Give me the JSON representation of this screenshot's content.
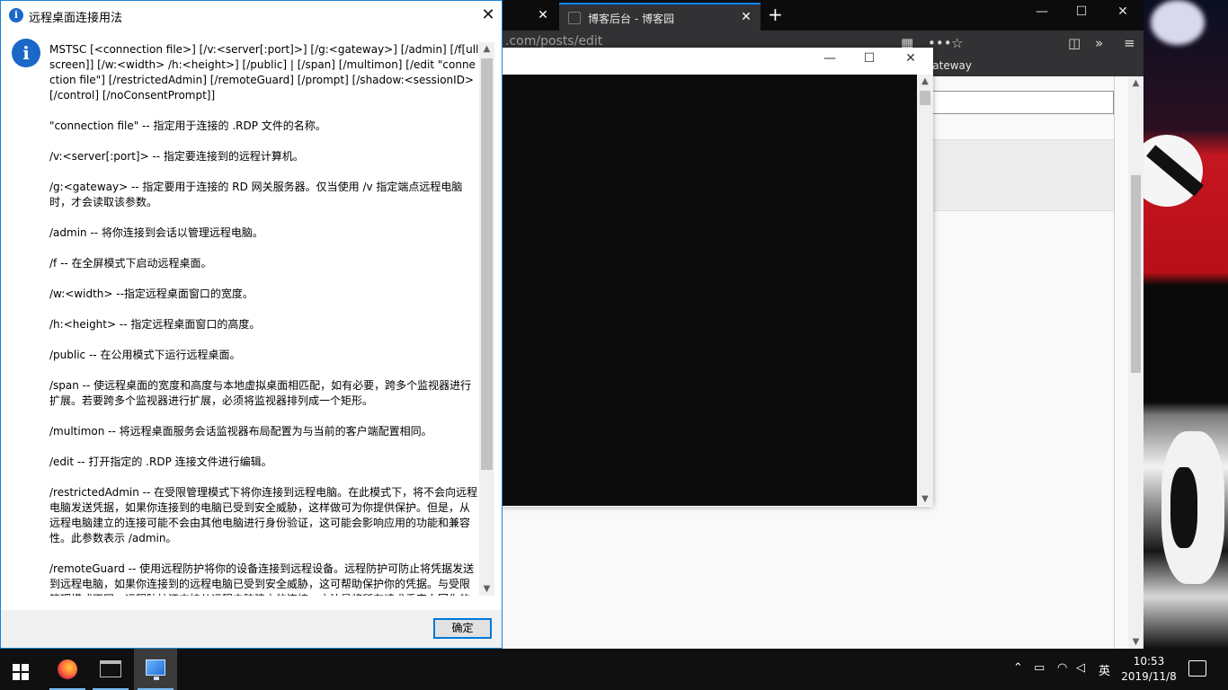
{
  "dialog": {
    "title": "远程桌面连接用法",
    "close_glyph": "✕",
    "ok_label": "确定",
    "paragraphs": [
      "MSTSC [<connection file>] [/v:<server[:port]>] [/g:<gateway>] [/admin] [/f[ullscreen]] [/w:<width> /h:<height>] [/public] | [/span] [/multimon] [/edit \"connection file\"] [/restrictedAdmin] [/remoteGuard] [/prompt] [/shadow:<sessionID> [/control] [/noConsentPrompt]]",
      "\"connection file\" -- 指定用于连接的 .RDP 文件的名称。",
      "/v:<server[:port]> -- 指定要连接到的远程计算机。",
      "/g:<gateway> -- 指定要用于连接的 RD 网关服务器。仅当使用 /v 指定端点远程电脑时，才会读取该参数。",
      "/admin -- 将你连接到会话以管理远程电脑。",
      "/f -- 在全屏模式下启动远程桌面。",
      "/w:<width> --指定远程桌面窗口的宽度。",
      "/h:<height> -- 指定远程桌面窗口的高度。",
      "/public -- 在公用模式下运行远程桌面。",
      "/span -- 使远程桌面的宽度和高度与本地虚拟桌面相匹配，如有必要，跨多个监视器进行扩展。若要跨多个监视器进行扩展，必须将监视器排列成一个矩形。",
      "/multimon -- 将远程桌面服务会话监视器布局配置为与当前的客户端配置相同。",
      "/edit -- 打开指定的 .RDP 连接文件进行编辑。",
      "/restrictedAdmin -- 在受限管理模式下将你连接到远程电脑。在此模式下，将不会向远程电脑发送凭据，如果你连接到的电脑已受到安全威胁，这样做可为你提供保护。但是，从远程电脑建立的连接可能不会由其他电脑进行身份验证，这可能会影响应用的功能和兼容性。此参数表示 /admin。",
      "/remoteGuard -- 使用远程防护将你的设备连接到远程设备。远程防护可防止将凭据发送到远程电脑，如果你连接到的远程电脑已受到安全威胁，这可帮助保护你的凭据。与受限管理模式不同，远程防护还支持从远程电脑建立的连接，方法是将所有请求重定向回你的设备。"
    ]
  },
  "browser": {
    "tab_title": "博客后台 - 博客园",
    "url": ".com/posts/edit",
    "bookmark": "Gateway"
  },
  "taskbar": {
    "time": "10:53",
    "date": "2019/11/8",
    "ime": "英",
    "apps": [
      "firefox",
      "command-prompt",
      "remote-desktop-connection"
    ]
  },
  "colors": {
    "accent": "#0078d7",
    "info_icon": "#1b68c8",
    "console_bg": "#0c0c0c"
  }
}
